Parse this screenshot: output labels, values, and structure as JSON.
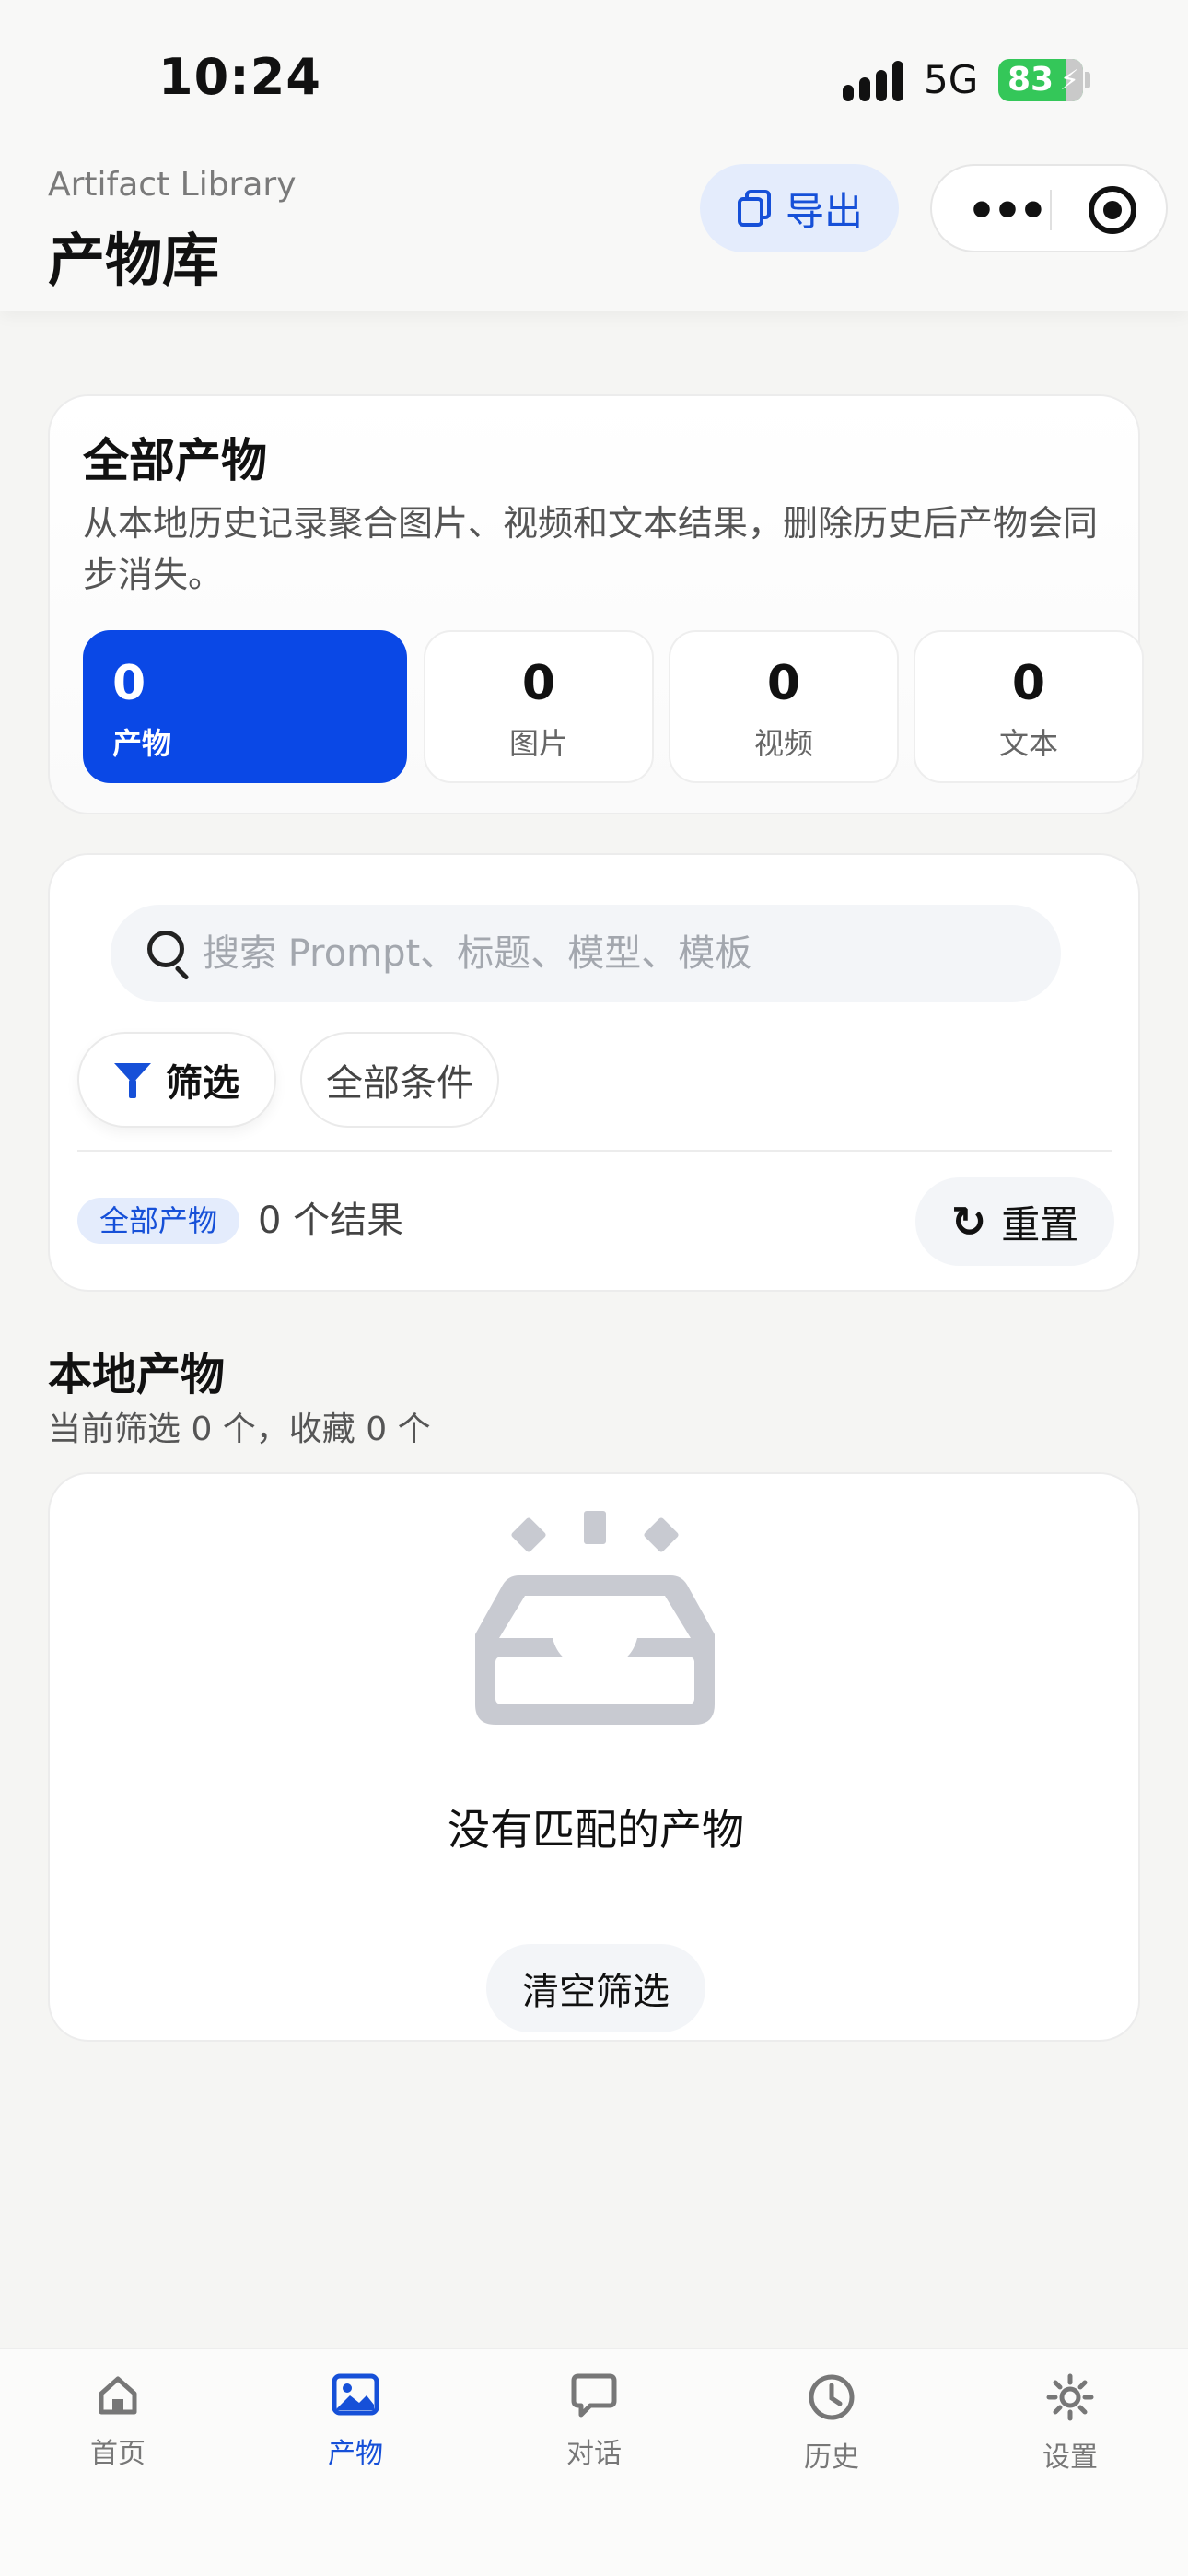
{
  "status_bar": {
    "time": "10:24",
    "network": "5G",
    "battery": "83"
  },
  "header": {
    "subtitle": "Artifact Library",
    "title": "产物库",
    "export_label": "导出"
  },
  "overview": {
    "title": "全部产物",
    "description": "从本地历史记录聚合图片、视频和文本结果，删除历史后产物会同步消失。",
    "stats": [
      {
        "value": "0",
        "label": "产物",
        "active": true
      },
      {
        "value": "0",
        "label": "图片",
        "active": false
      },
      {
        "value": "0",
        "label": "视频",
        "active": false
      },
      {
        "value": "0",
        "label": "文本",
        "active": false
      }
    ]
  },
  "filters": {
    "search_placeholder": "搜索 Prompt、标题、模型、模板",
    "filter_label": "筛选",
    "conditions_label": "全部条件",
    "active_tag": "全部产物",
    "result_count": "0 个结果",
    "reset_label": "重置"
  },
  "local": {
    "title": "本地产物",
    "subtitle": "当前筛选 0 个，收藏 0 个"
  },
  "empty": {
    "message": "没有匹配的产物",
    "clear_label": "清空筛选"
  },
  "tabbar": {
    "items": [
      {
        "label": "首页",
        "icon": "home-icon"
      },
      {
        "label": "产物",
        "icon": "image-icon"
      },
      {
        "label": "对话",
        "icon": "chat-icon"
      },
      {
        "label": "历史",
        "icon": "clock-icon"
      },
      {
        "label": "设置",
        "icon": "gear-icon"
      }
    ],
    "active_index": 1
  },
  "colors": {
    "accent": "#1650d8",
    "accent_fill": "#0a48e6",
    "accent_soft": "#e4ecfc",
    "battery": "#34c759"
  }
}
